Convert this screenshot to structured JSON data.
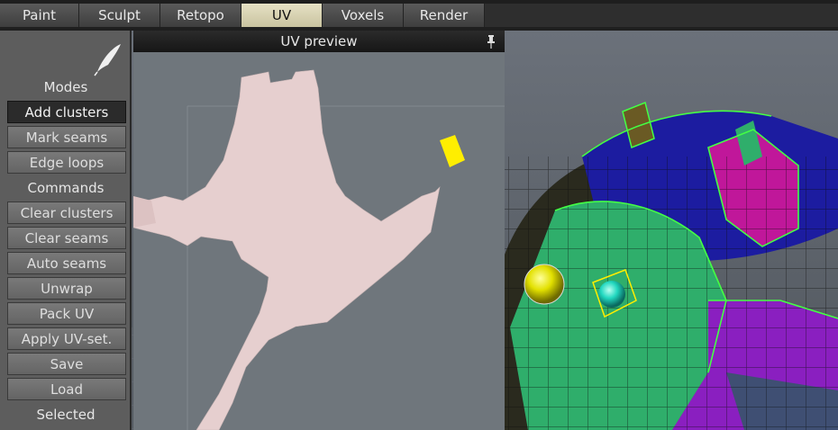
{
  "tabs": [
    {
      "label": "Paint",
      "active": false
    },
    {
      "label": "Sculpt",
      "active": false
    },
    {
      "label": "Retopo",
      "active": false
    },
    {
      "label": "UV",
      "active": true
    },
    {
      "label": "Voxels",
      "active": false
    },
    {
      "label": "Render",
      "active": false
    }
  ],
  "panel": {
    "modes_label": "Modes",
    "add_clusters": "Add clusters",
    "mark_seams": "Mark seams",
    "edge_loops": "Edge loops",
    "commands_label": "Commands",
    "clear_clusters": "Clear clusters",
    "clear_seams": "Clear seams",
    "auto_seams": "Auto seams",
    "unwrap": "Unwrap",
    "pack_uv": "Pack UV",
    "apply_uv_set": "Apply UV-set.",
    "save": "Save",
    "load": "Load",
    "selected_label": "Selected"
  },
  "uv_preview": {
    "title": "UV preview",
    "pin_icon": "pin-icon"
  },
  "colors": {
    "active_tab": "#d8d2b2",
    "island": "#e6cfcf",
    "selected_island": "#ffee00",
    "cluster_blue": "#1c1ca0",
    "cluster_green": "#2fae6b",
    "cluster_magenta": "#c0179a",
    "cluster_purple": "#8a1fc0",
    "seam": "#44ff44"
  }
}
